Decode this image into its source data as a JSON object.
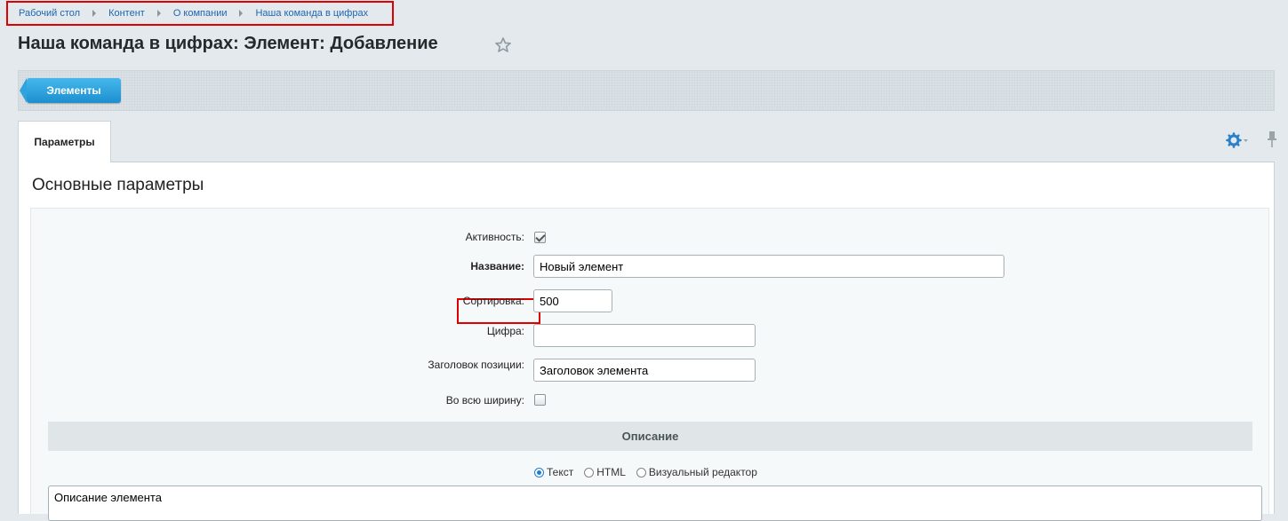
{
  "breadcrumb": {
    "items": [
      "Рабочий стол",
      "Контент",
      "О компании",
      "Наша команда в цифрах"
    ]
  },
  "page": {
    "title": "Наша команда в цифрах: Элемент: Добавление"
  },
  "toolbar": {
    "elements_label": "Элементы"
  },
  "tabs": [
    {
      "label": "Параметры",
      "active": true
    }
  ],
  "section": {
    "title": "Основные параметры"
  },
  "form": {
    "active": {
      "label": "Активность:",
      "checked": true
    },
    "name": {
      "label": "Название:",
      "value": "Новый элемент"
    },
    "sort": {
      "label": "Сортировка:",
      "value": "500"
    },
    "digit": {
      "label": "Цифра:",
      "value": ""
    },
    "position_title": {
      "label": "Заголовок позиции:",
      "value": "Заголовок элемента"
    },
    "full_width": {
      "label": "Во всю ширину:",
      "checked": false
    }
  },
  "description": {
    "header": "Описание",
    "modes": [
      "Текст",
      "HTML",
      "Визуальный редактор"
    ],
    "selected_mode": "Текст",
    "value": "Описание элемента"
  },
  "icons": {
    "favorite": "star-icon",
    "settings": "gear-icon",
    "pin": "pin-icon"
  },
  "colors": {
    "accent": "#2a9ddf",
    "highlight": "#e00000",
    "link": "#2067b0"
  }
}
